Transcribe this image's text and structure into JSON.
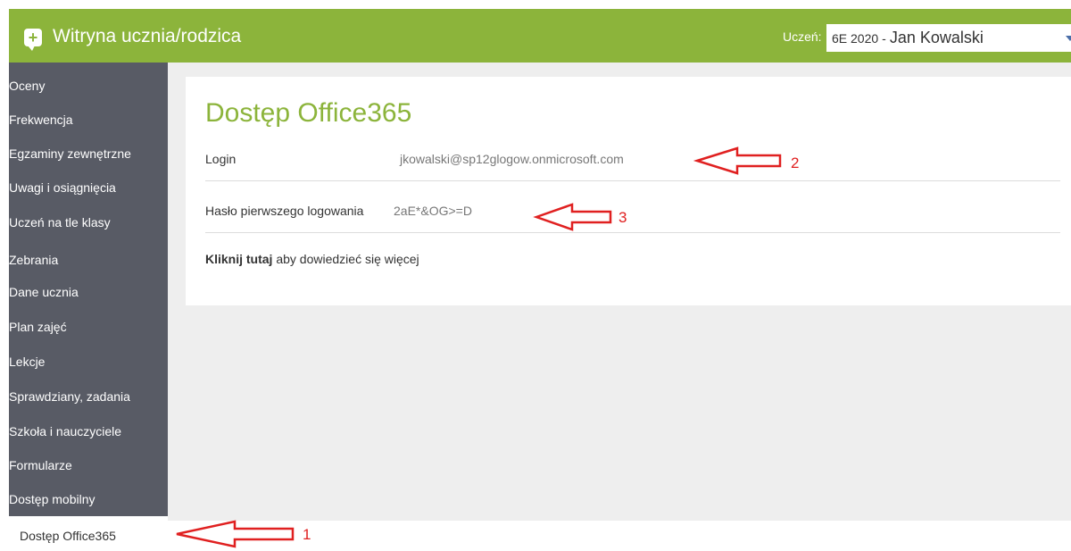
{
  "header": {
    "title": "Witryna ucznia/rodzica",
    "student_label": "Uczeń:",
    "student_class": "6E 2020",
    "student_separator": "-",
    "student_name": "Jan Kowalski"
  },
  "sidebar": {
    "items": [
      {
        "label": "Oceny"
      },
      {
        "label": "Frekwencja"
      },
      {
        "label": "Egzaminy zewnętrzne"
      },
      {
        "label": "Uwagi i osiągnięcia"
      },
      {
        "label": "Uczeń na tle klasy"
      },
      {
        "label": "Zebrania"
      },
      {
        "label": "Dane ucznia"
      },
      {
        "label": "Plan zajęć"
      },
      {
        "label": "Lekcje"
      },
      {
        "label": "Sprawdziany, zadania"
      },
      {
        "label": "Szkoła i nauczyciele"
      },
      {
        "label": "Formularze"
      },
      {
        "label": "Dostęp mobilny"
      }
    ],
    "active_label": "Dostęp Office365"
  },
  "main": {
    "title": "Dostęp Office365",
    "login_label": "Login",
    "login_value": "jkowalski@sp12glogow.onmicrosoft.com",
    "password_label": "Hasło pierwszego logowania",
    "password_value": "2aE*&OG>=D",
    "link_bold": "Kliknij tutaj",
    "link_rest": "aby dowiedzieć się więcej"
  },
  "annotations": [
    {
      "number": "1"
    },
    {
      "number": "2"
    },
    {
      "number": "3"
    }
  ],
  "colors": {
    "accent": "#8cb43b",
    "sidebar": "#585b65",
    "content_bg": "#eeeeee",
    "annotation": "#e02020"
  }
}
